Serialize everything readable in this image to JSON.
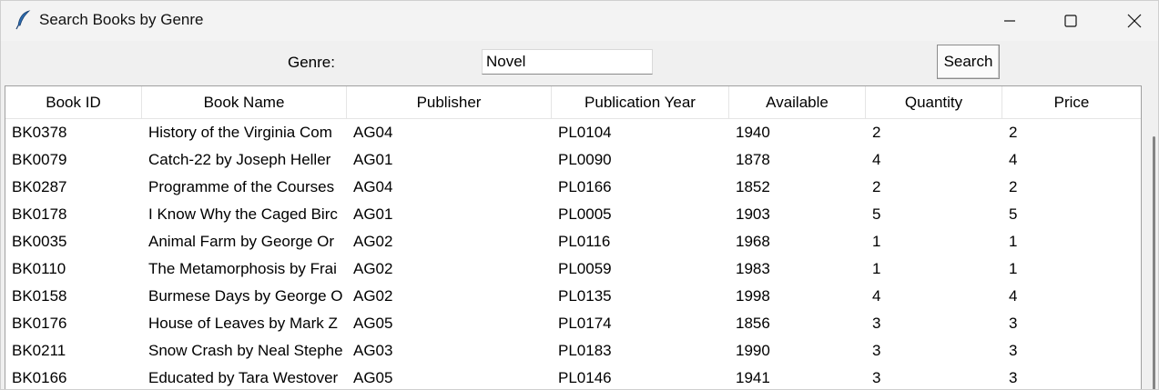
{
  "window": {
    "title": "Search Books by Genre",
    "app_icon": "feather-icon"
  },
  "controls": {
    "minimize_icon": "minimize-icon",
    "maximize_icon": "maximize-icon",
    "close_icon": "close-icon"
  },
  "search": {
    "label": "Genre:",
    "value": "Novel",
    "button_label": "Search"
  },
  "table": {
    "columns": [
      "Book ID",
      "Book Name",
      "Publisher",
      "Publication Year",
      "Available",
      "Quantity",
      "Price"
    ],
    "rows": [
      [
        "BK0378",
        "History of the Virginia Com",
        "AG04",
        "PL0104",
        "1940",
        "2",
        "2"
      ],
      [
        "BK0079",
        "Catch-22 by Joseph Heller",
        "AG01",
        "PL0090",
        "1878",
        "4",
        "4"
      ],
      [
        "BK0287",
        "Programme of the Courses",
        "AG04",
        "PL0166",
        "1852",
        "2",
        "2"
      ],
      [
        "BK0178",
        "I Know Why the Caged Birc",
        "AG01",
        "PL0005",
        "1903",
        "5",
        "5"
      ],
      [
        "BK0035",
        "Animal Farm by George Or",
        "AG02",
        "PL0116",
        "1968",
        "1",
        "1"
      ],
      [
        "BK0110",
        "The Metamorphosis by Frai",
        "AG02",
        "PL0059",
        "1983",
        "1",
        "1"
      ],
      [
        "BK0158",
        "Burmese Days by George O",
        "AG02",
        "PL0135",
        "1998",
        "4",
        "4"
      ],
      [
        "BK0176",
        "House of Leaves by Mark Z",
        "AG05",
        "PL0174",
        "1856",
        "3",
        "3"
      ],
      [
        "BK0211",
        "Snow Crash by Neal Stephe",
        "AG03",
        "PL0183",
        "1990",
        "3",
        "3"
      ],
      [
        "BK0166",
        "Educated by Tara Westover",
        "AG05",
        "PL0146",
        "1941",
        "3",
        "3"
      ]
    ]
  }
}
